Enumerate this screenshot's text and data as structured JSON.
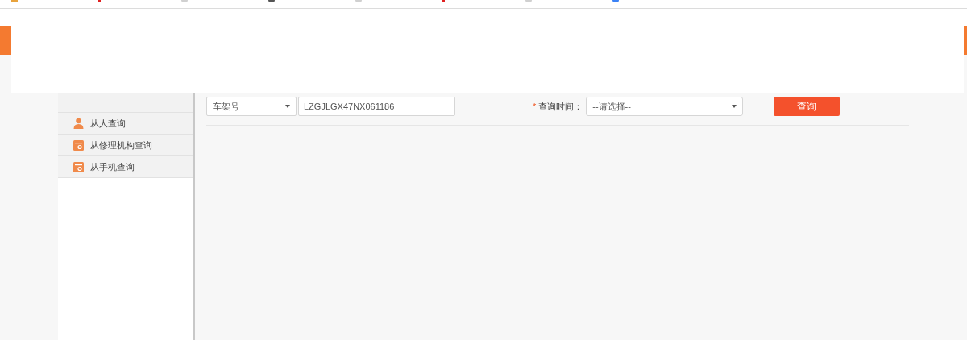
{
  "sidebar": {
    "items": [
      {
        "label": "从人查询",
        "kind": "person"
      },
      {
        "label": "从修理机构查询",
        "kind": "card"
      },
      {
        "label": "从手机查询",
        "kind": "card"
      }
    ]
  },
  "search_form": {
    "search_by": {
      "value": "车架号"
    },
    "vin": {
      "value": "LZGJLGX47NX061186"
    },
    "query_time": {
      "required_mark": "*",
      "label": "查询时间：",
      "value": "--请选择--"
    },
    "submit_button": "查询"
  }
}
